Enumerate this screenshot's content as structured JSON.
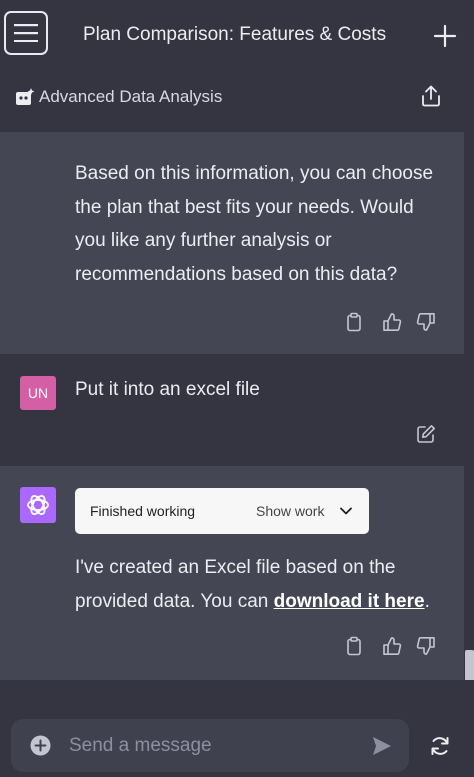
{
  "header": {
    "title": "Plan Comparison: Features & Costs",
    "model_label": "Advanced Data Analysis"
  },
  "messages": [
    {
      "role": "assistant",
      "text": "Based on this information, you can choose the plan that best fits your needs. Would you like any further analysis or recommendations based on this data?"
    },
    {
      "role": "user",
      "avatar_initials": "UN",
      "text": "Put it into an excel file"
    },
    {
      "role": "assistant",
      "work_status": "Finished working",
      "show_work_label": "Show work",
      "text_before_link": "I've created an Excel file based on the provided data. You can ",
      "link_text": "download it here",
      "text_after_link": "."
    }
  ],
  "composer": {
    "placeholder": "Send a message"
  },
  "colors": {
    "background": "#343541",
    "assistant_message_bg": "#444654",
    "user_avatar": "#d45fa4",
    "assistant_avatar": "#ab68ff"
  },
  "icons": [
    "menu-icon",
    "plus-icon",
    "model-icon",
    "share-icon",
    "copy-icon",
    "thumbs-up-icon",
    "thumbs-down-icon",
    "edit-icon",
    "openai-logo-icon",
    "chevron-down-icon",
    "add-circle-icon",
    "send-icon",
    "regenerate-icon"
  ]
}
